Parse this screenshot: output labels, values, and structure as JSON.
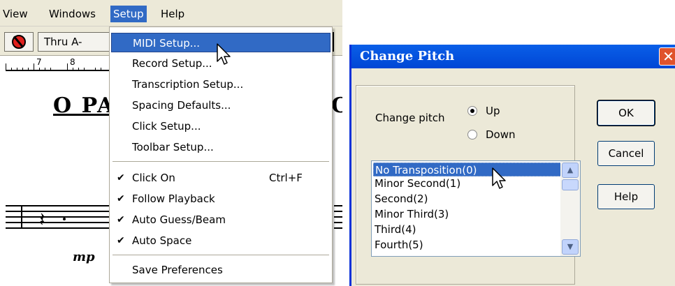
{
  "menubar": {
    "items": [
      "View",
      "Windows",
      "Setup",
      "Help"
    ],
    "active": "Setup"
  },
  "toolbar": {
    "thru_label": "Thru A-"
  },
  "ruler": {
    "numbers": [
      "7",
      "8"
    ]
  },
  "score": {
    "title_fragment": "O PA",
    "title_tail": "C",
    "dynamic": "mp"
  },
  "setup_menu": {
    "items": [
      {
        "label": "MIDI Setup...",
        "highlighted": true
      },
      {
        "label": "Record Setup..."
      },
      {
        "label": "Transcription Setup..."
      },
      {
        "label": "Spacing Defaults..."
      },
      {
        "label": "Click Setup..."
      },
      {
        "label": "Toolbar Setup..."
      }
    ],
    "toggles": [
      {
        "label": "Click On",
        "checked": true,
        "shortcut": "Ctrl+F"
      },
      {
        "label": "Follow Playback",
        "checked": true
      },
      {
        "label": "Auto Guess/Beam",
        "checked": true
      },
      {
        "label": "Auto Space",
        "checked": true
      }
    ],
    "footer": "Save Preferences"
  },
  "dialog": {
    "title": "Change Pitch",
    "close_glyph": "✕",
    "change_pitch_label": "Change pitch",
    "radio_up": "Up",
    "radio_down": "Down",
    "selected_radio": "Up",
    "transpositions": [
      "No Transposition(0)",
      "Minor Second(1)",
      "Second(2)",
      "Minor Third(3)",
      "Third(4)",
      "Fourth(5)"
    ],
    "selected_transposition": "No Transposition(0)",
    "ok_label": "OK",
    "cancel_label": "Cancel",
    "help_label": "Help"
  },
  "colors": {
    "selection": "#316ac5",
    "window_face": "#ece9d8",
    "titlebar": "#0a5fe8",
    "close_button": "#e0532c"
  }
}
